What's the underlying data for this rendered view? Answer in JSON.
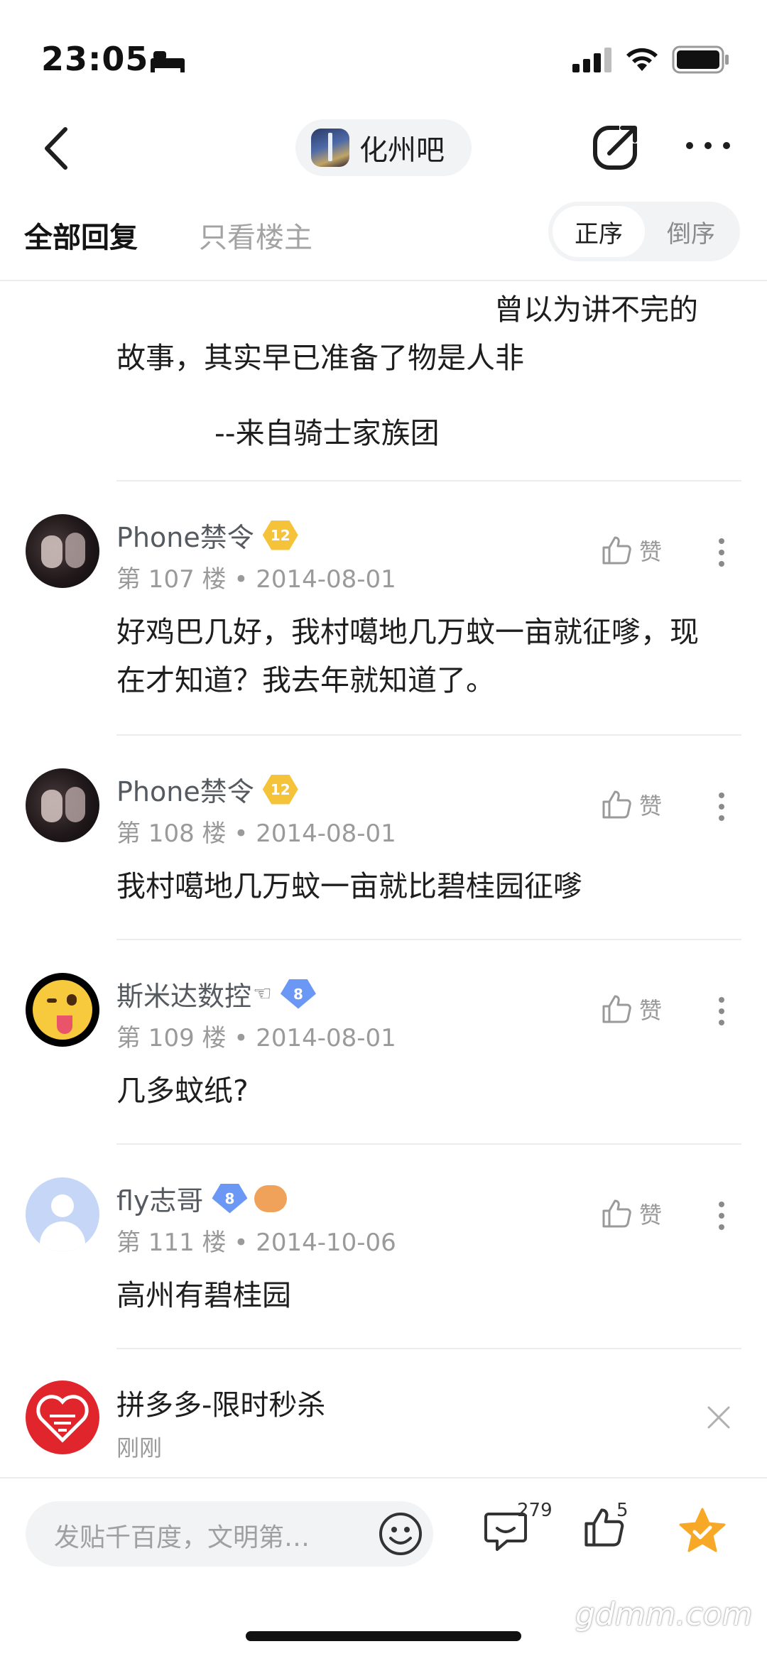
{
  "status_bar": {
    "time": "23:05"
  },
  "nav": {
    "forum_name": "化州吧"
  },
  "tabs": {
    "all_replies": "全部回复",
    "only_op": "只看楼主",
    "order_asc": "正序",
    "order_desc": "倒序"
  },
  "quote": {
    "line1": "曾以为讲不完的",
    "line2": "故事，其实早已准备了物是人非",
    "line3": "--来自骑士家族团"
  },
  "posts": [
    {
      "username": "Phone禁令",
      "level": "12",
      "floor": "第 107 楼",
      "date": "2014-08-01",
      "like_label": "赞",
      "text": "好鸡巴几好，我村噶地几万蚊一亩就征嗲，现在才知道？我去年就知道了。"
    },
    {
      "username": "Phone禁令",
      "level": "12",
      "floor": "第 108 楼",
      "date": "2014-08-01",
      "like_label": "赞",
      "text": "我村噶地几万蚊一亩就比碧桂园征嗲"
    },
    {
      "username": "斯米达数控",
      "hand": "☜",
      "level": "8",
      "floor": "第 109 楼",
      "date": "2014-08-01",
      "like_label": "赞",
      "text": "几多蚊纸?"
    },
    {
      "username": "fly志哥",
      "level": "8",
      "floor": "第 111 楼",
      "date": "2014-10-06",
      "like_label": "赞",
      "text": "高州有碧桂园"
    }
  ],
  "meta_separator": "•",
  "ad": {
    "title": "拼多多-限时秒杀",
    "time": "刚刚"
  },
  "bottom_bar": {
    "input_placeholder": "发贴千百度，文明第…",
    "reply_count": "279",
    "like_count": "5"
  },
  "watermark": "gdmm.com"
}
